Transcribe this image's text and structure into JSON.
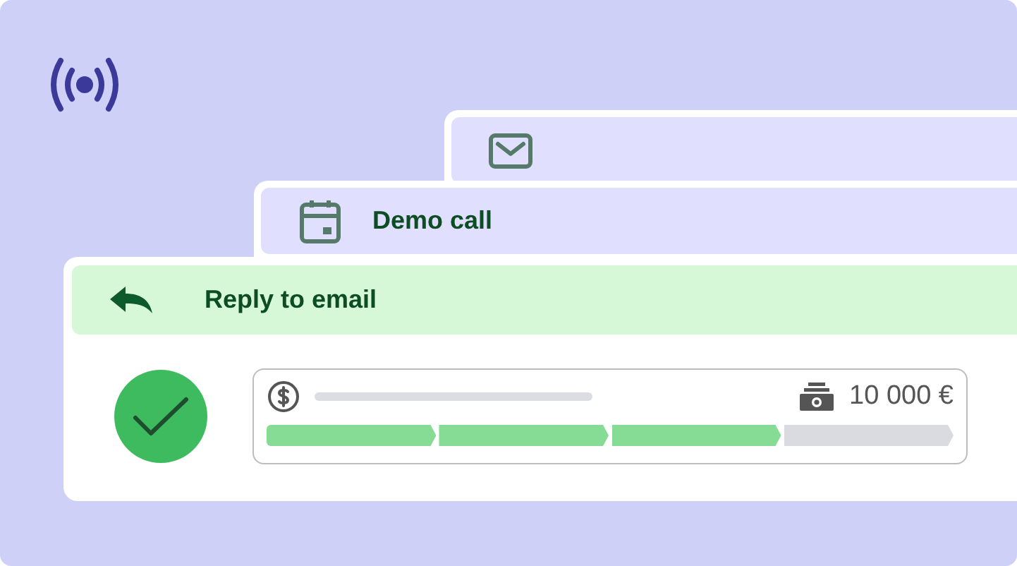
{
  "cards": [
    {
      "kind": "email"
    },
    {
      "kind": "calendar",
      "title": "Demo call"
    },
    {
      "kind": "reply",
      "title": "Reply to email"
    }
  ],
  "task": {
    "done": true
  },
  "deal": {
    "amount": "10 000 €",
    "stages": [
      {
        "done": true
      },
      {
        "done": true
      },
      {
        "done": true
      },
      {
        "done": false
      }
    ]
  }
}
